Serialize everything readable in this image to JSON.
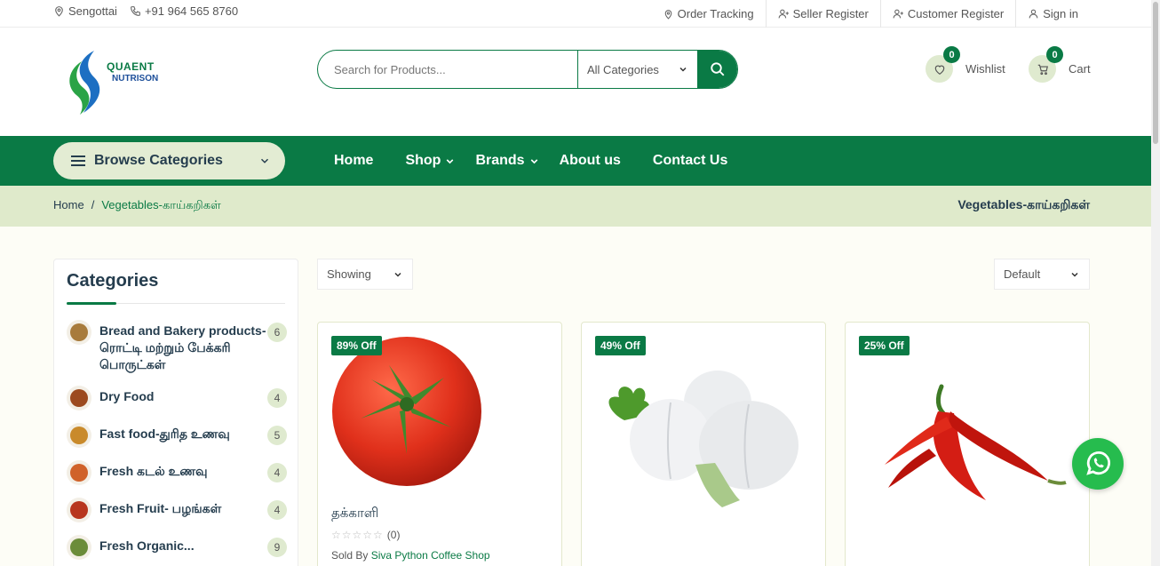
{
  "topbar": {
    "location": "Sengottai",
    "phone": "+91 964 565 8760",
    "links": [
      "Order Tracking",
      "Seller Register",
      "Customer Register",
      "Sign in"
    ]
  },
  "header": {
    "logo_line1": "QUAENT",
    "logo_line2": "NUTRISON",
    "search_placeholder": "Search for Products...",
    "category_select": "All Categories",
    "wishlist_label": "Wishlist",
    "wishlist_count": "0",
    "cart_label": "Cart",
    "cart_count": "0"
  },
  "nav": {
    "browse_label": "Browse Categories",
    "items": [
      "Home",
      "Shop",
      "Brands",
      "About us",
      "Contact Us"
    ]
  },
  "breadcrumb": {
    "home": "Home",
    "separator": "/",
    "current": "Vegetables-காய்கறிகள்",
    "title": "Vegetables-காய்கறிகள்"
  },
  "sidebar": {
    "title": "Categories",
    "categories": [
      {
        "name": "Bread and Bakery products-ரொட்டி மற்றும் பேக்கரி பொருட்கள்",
        "count": "6",
        "color": "#a87b3c"
      },
      {
        "name": "Dry Food",
        "count": "4",
        "color": "#9c4a1f"
      },
      {
        "name": "Fast food-துரித உணவு",
        "count": "5",
        "color": "#c98a2b"
      },
      {
        "name": "Fresh கடல் உணவு",
        "count": "4",
        "color": "#d0622a"
      },
      {
        "name": "Fresh Fruit- பழங்கள்",
        "count": "4",
        "color": "#b8361e"
      },
      {
        "name": "Fresh Organic...",
        "count": "9",
        "color": "#6b8c3a"
      }
    ]
  },
  "filters": {
    "showing": "Showing",
    "sort": "Default"
  },
  "products": [
    {
      "discount": "89% Off",
      "name": "தக்காளி",
      "reviews": "(0)",
      "sold_by_label": "Sold By",
      "seller": "Siva Python Coffee Shop"
    },
    {
      "discount": "49% Off",
      "name": "",
      "reviews": "",
      "sold_by_label": "",
      "seller": ""
    },
    {
      "discount": "25% Off",
      "name": "",
      "reviews": "",
      "sold_by_label": "",
      "seller": ""
    }
  ],
  "colors": {
    "brand_green": "#0a7a45",
    "light_green": "#dfeacb"
  }
}
